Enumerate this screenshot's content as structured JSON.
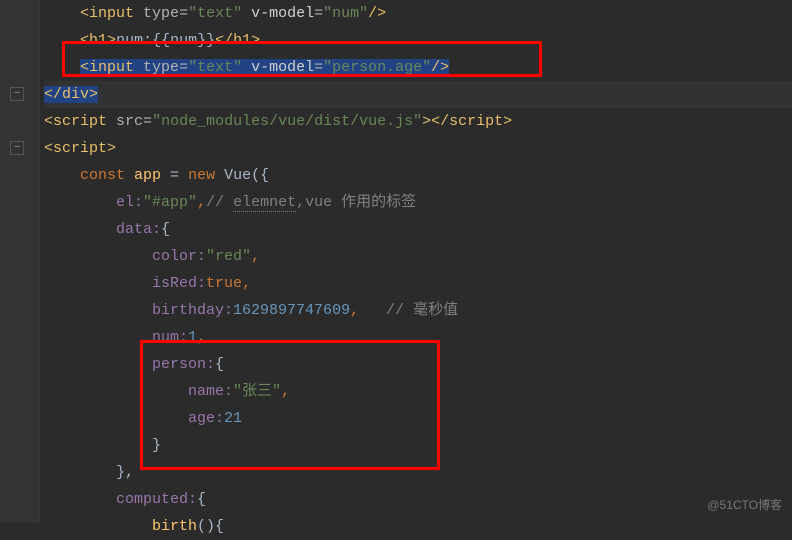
{
  "code": {
    "l1": {
      "i": "    ",
      "open": "<",
      "tag": "input ",
      "a1": "type",
      "eq": "=",
      "v1": "\"text\" ",
      "a2": "v-model",
      "v2": "\"num\"",
      "close": "/>"
    },
    "l2": {
      "i": "    ",
      "open": "<",
      "tag": "h1",
      "gt": ">",
      "txt": "num:{{num}}",
      "open2": "</",
      "tag2": "h1",
      "gt2": ">"
    },
    "l3": {
      "i": "    ",
      "open": "<",
      "tag": "input ",
      "a1": "type",
      "eq": "=",
      "v1": "\"text\" ",
      "a2": "v-model",
      "v2": "\"person.age\"",
      "close": "/>"
    },
    "l4": {
      "open": "</",
      "tag": "div",
      "gt": ">"
    },
    "l5": {
      "open": "<",
      "tag": "script ",
      "a1": "src",
      "eq": "=",
      "v1": "\"node_modules/vue/dist/vue.js\"",
      "gt": ">",
      "open2": "</",
      "tag2": "script",
      "gt2": ">"
    },
    "l6": {
      "open": "<",
      "tag": "script",
      "gt": ">"
    },
    "l7": {
      "i": "    ",
      "kw": "const ",
      "id": "app ",
      "eq": "= ",
      "kw2": "new ",
      "cls": "Vue",
      "p": "({"
    },
    "l8": {
      "i": "        ",
      "key": "el:",
      "val": "\"#app\"",
      "c": ",",
      "cm": "// ",
      "cmu": "elemnet",
      "cm2": ",vue 作用的标签"
    },
    "l9": {
      "i": "        ",
      "key": "data:",
      "p": "{"
    },
    "l10": {
      "i": "            ",
      "key": "color:",
      "val": "\"red\"",
      "c": ","
    },
    "l11": {
      "i": "            ",
      "key": "isRed:",
      "val": "true",
      "c": ","
    },
    "l12": {
      "i": "            ",
      "key": "birthday:",
      "val": "1629897747609",
      "c": ",   ",
      "cm": "// 毫秒值"
    },
    "l13": {
      "i": "            ",
      "key": "num:",
      "val": "1",
      "c": ","
    },
    "l14": {
      "i": "            ",
      "key": "person:",
      "p": "{"
    },
    "l15": {
      "i": "                ",
      "key": "name:",
      "val": "\"张三\"",
      "c": ","
    },
    "l16": {
      "i": "                ",
      "key": "age:",
      "val": "21"
    },
    "l17": {
      "i": "            ",
      "p": "}"
    },
    "l18": {
      "i": "        ",
      "p": "},"
    },
    "l19": {
      "i": "        ",
      "key": "computed:",
      "p": "{"
    },
    "l20": {
      "i": "            ",
      "id": "birth",
      "p": "(){"
    }
  },
  "watermark": "@51CTO博客"
}
